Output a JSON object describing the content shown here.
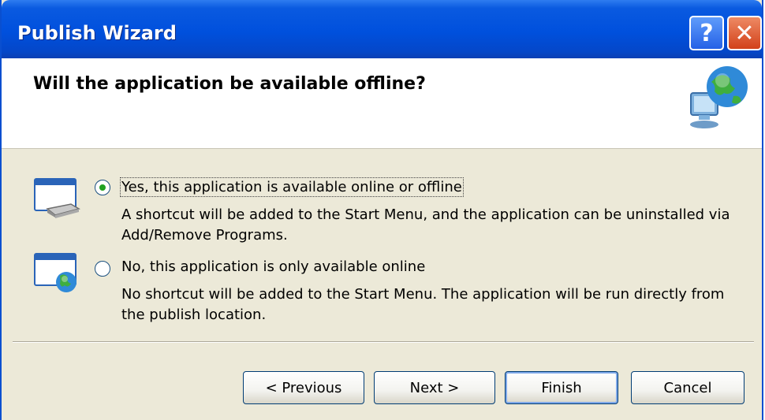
{
  "window": {
    "title": "Publish Wizard"
  },
  "titlebar": {
    "help_label": "?",
    "close_label": "✕"
  },
  "header": {
    "title": "Will the application be available offline?"
  },
  "options": [
    {
      "label": "Yes, this application is available online or offline",
      "description": "A shortcut will be added to the Start Menu, and the application can be uninstalled via Add/Remove Programs.",
      "selected": true,
      "icon": "window-drive-icon"
    },
    {
      "label": "No, this application is only available online",
      "description": "No shortcut will be added to the Start Menu. The application will be run directly from the publish location.",
      "selected": false,
      "icon": "window-globe-icon"
    }
  ],
  "buttons": {
    "previous": "< Previous",
    "next": "Next >",
    "finish": "Finish",
    "cancel": "Cancel"
  },
  "colors": {
    "titlebar": "#0050dd",
    "dialog_background": "#ece9d8",
    "header_background": "#ffffff",
    "radio_checked": "#21a121"
  }
}
